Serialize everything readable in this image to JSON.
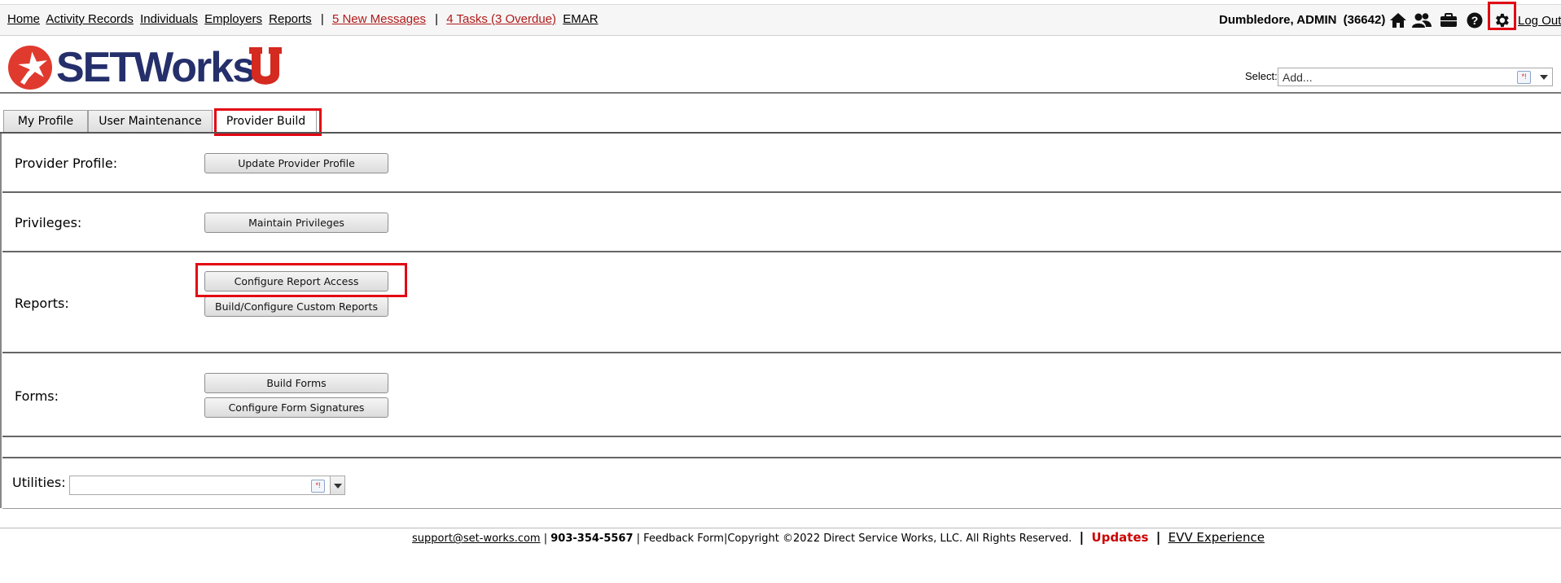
{
  "nav": {
    "home": "Home",
    "activity_records": "Activity Records",
    "individuals": "Individuals",
    "employers": "Employers",
    "reports": "Reports",
    "separator": "|",
    "messages": "5 New Messages",
    "tasks": "4 Tasks (3 Overdue)",
    "emar": "EMAR"
  },
  "user": {
    "name": "Dumbledore, ADMIN",
    "id": "(36642)",
    "logout": "Log Out"
  },
  "icons": {
    "home": "home-icon",
    "people": "people-icon",
    "briefcase": "briefcase-icon",
    "help": "help-icon",
    "settings": "gear-icon"
  },
  "logo": {
    "text": "SETWorks"
  },
  "select": {
    "label": "Select:",
    "placeholder": "Add..."
  },
  "tabs": [
    {
      "label": "My Profile"
    },
    {
      "label": "User Maintenance"
    },
    {
      "label": "Provider Build"
    }
  ],
  "sections": {
    "provider_profile": {
      "label": "Provider Profile:",
      "buttons": [
        "Update Provider Profile"
      ]
    },
    "privileges": {
      "label": "Privileges:",
      "buttons": [
        "Maintain Privileges"
      ]
    },
    "reports": {
      "label": "Reports:",
      "buttons": [
        "Configure Report Access",
        "Build/Configure Custom Reports"
      ]
    },
    "forms": {
      "label": "Forms:",
      "buttons": [
        "Build Forms",
        "Configure Form Signatures"
      ]
    },
    "utilities": {
      "label": "Utilities:"
    }
  },
  "footer": {
    "email": "support@set-works.com",
    "phone": "903-354-5567",
    "feedback": "Feedback Form",
    "copyright": "Copyright ©2022 Direct Service Works, LLC. All Rights Reserved.",
    "updates": "Updates",
    "evv": "EVV Experience"
  },
  "colors": {
    "brand_navy": "#252f6b",
    "brand_red": "#e03a2f",
    "highlight_red": "#e30613",
    "alert_link": "#b01a1a"
  }
}
